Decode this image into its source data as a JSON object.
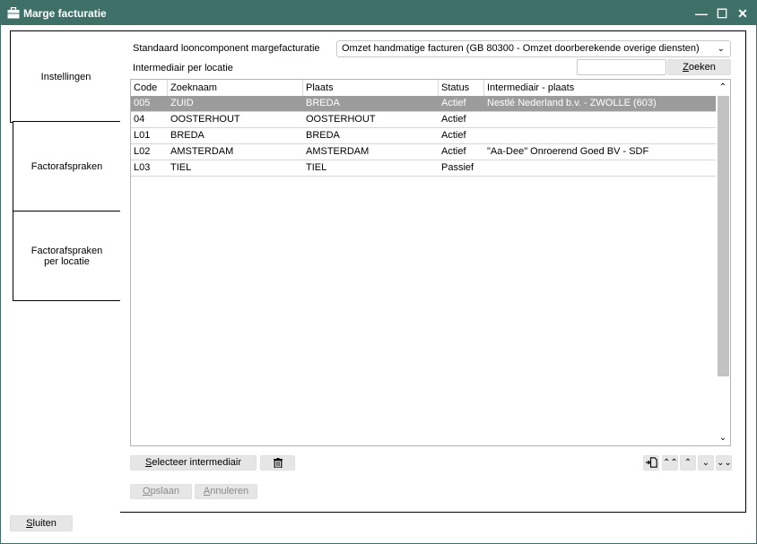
{
  "window": {
    "title": "Marge facturatie",
    "icon": "briefcase-icon",
    "controls": {
      "minimize": "—",
      "maximize": "☐",
      "close": "✕"
    }
  },
  "tabs": [
    {
      "label_line1": "Instellingen",
      "label_line2": ""
    },
    {
      "label_line1": "Factorafspraken",
      "label_line2": ""
    },
    {
      "label_line1": "Factorafspraken",
      "label_line2": "per locatie"
    }
  ],
  "settings": {
    "loon_label": "Standaard looncomponent margefacturatie",
    "loon_value": "Omzet handmatige facturen (GB 80300 - Omzet doorberekende overige diensten)",
    "intermediair_label": "Intermediair per locatie",
    "search_value": "",
    "search_button_prefix": "",
    "search_button_accel": "Z",
    "search_button_rest": "oeken"
  },
  "table": {
    "columns": [
      "Code",
      "Zoeknaam",
      "Plaats",
      "Status",
      "Intermediair - plaats"
    ],
    "rows": [
      {
        "code": "005",
        "zoeknaam": "ZUID",
        "plaats": "BREDA",
        "status": "Actief",
        "intermediair": "Nestlé Nederland b.v. - ZWOLLE (603)"
      },
      {
        "code": "04",
        "zoeknaam": "OOSTERHOUT",
        "plaats": "OOSTERHOUT",
        "status": "Actief",
        "intermediair": ""
      },
      {
        "code": "L01",
        "zoeknaam": "BREDA",
        "plaats": "BREDA",
        "status": "Actief",
        "intermediair": ""
      },
      {
        "code": "L02",
        "zoeknaam": "AMSTERDAM",
        "plaats": "AMSTERDAM",
        "status": "Actief",
        "intermediair": "\"Aa-Dee\" Onroerend Goed BV - SDF"
      },
      {
        "code": "L03",
        "zoeknaam": "TIEL",
        "plaats": "TIEL",
        "status": "Passief",
        "intermediair": ""
      }
    ],
    "selected_row": 0
  },
  "actions": {
    "select_accel": "S",
    "select_rest": "electeer intermediair",
    "delete_icon": "trash-icon",
    "save_accel": "O",
    "save_rest": "pslaan",
    "cancel_accel": "A",
    "cancel_rest": "nnuleren",
    "close_accel": "S",
    "close_rest": "luiten"
  },
  "colors": {
    "titlebar": "#3f7068",
    "selected_row": "#9c9c9c",
    "button": "#e6e6e6"
  }
}
